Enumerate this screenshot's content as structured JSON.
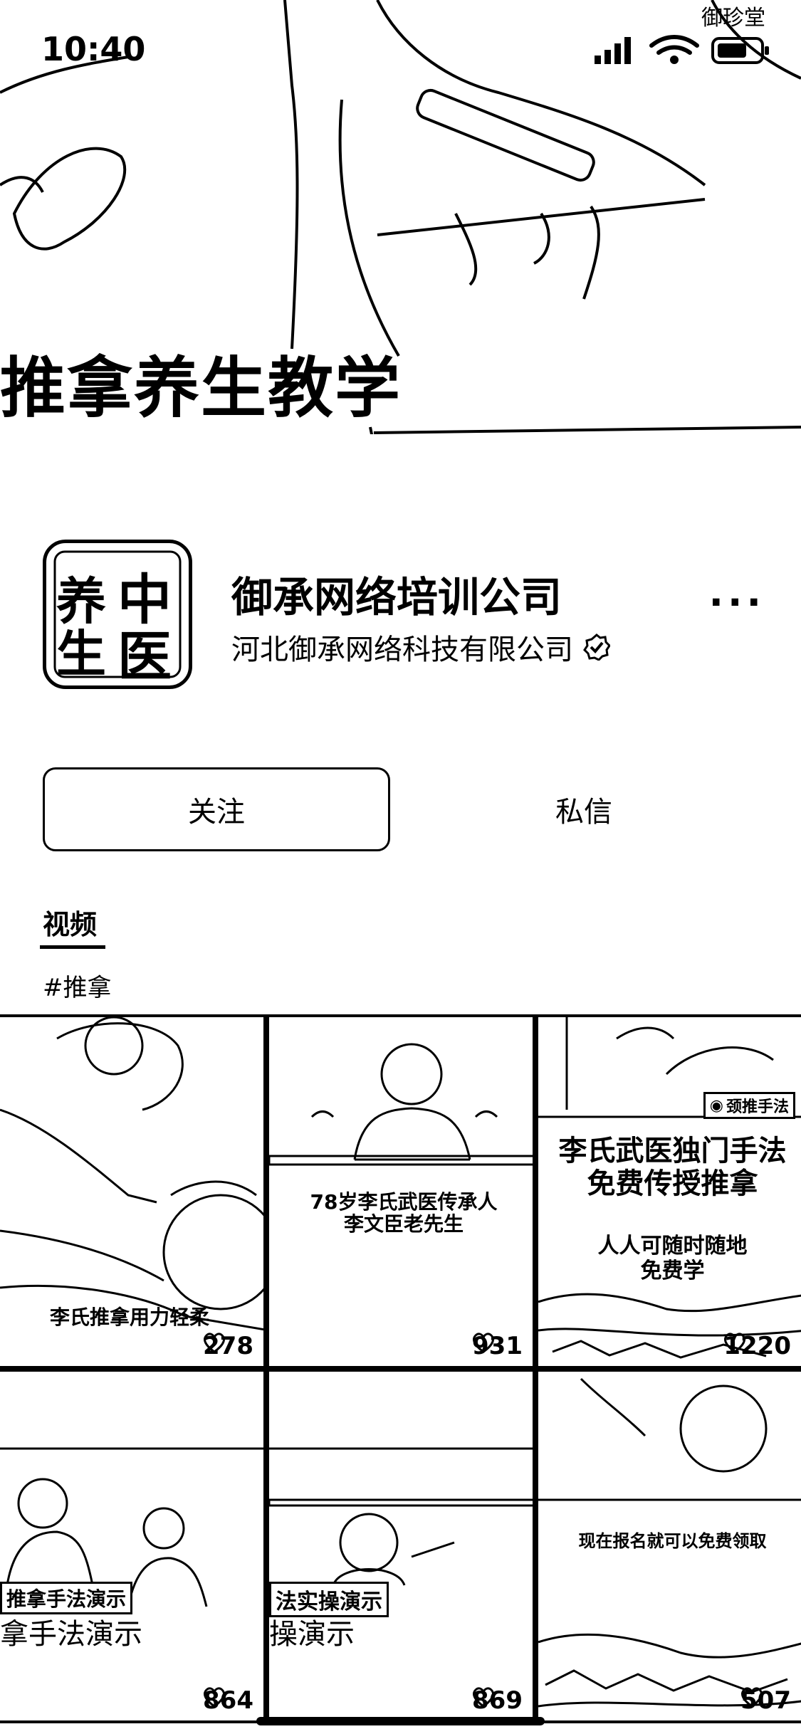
{
  "status_bar": {
    "time": "10:40"
  },
  "cover": {
    "title": "推拿养生教学",
    "corner_text": "御珍堂"
  },
  "profile": {
    "avatar_chars": [
      "中",
      "医",
      "养",
      "生"
    ],
    "name": "御承网络培训公司",
    "company": "河北御承网络科技有限公司",
    "more": "···"
  },
  "actions": {
    "follow": "关注",
    "message": "私信"
  },
  "tabs": {
    "video": "视频"
  },
  "hashtag": "#推拿",
  "videos": [
    {
      "caption": "李氏推拿用力轻柔",
      "likes": "278"
    },
    {
      "caption": "78岁李氏武医传承人\n李文臣老先生",
      "likes": "931"
    },
    {
      "caption_top": "李氏武医独门手法\n免费传授推拿",
      "caption_sub": "人人可随时随地\n免费学",
      "badge": "颈推手法",
      "likes": "1220"
    },
    {
      "caption_small": "推拿手法演示",
      "caption_big": "拿手法演示",
      "likes": "864"
    },
    {
      "caption_small": "法实操演示",
      "caption_big": "操演示",
      "likes": "869"
    },
    {
      "caption": "现在报名就可以免费领取",
      "likes": "507"
    }
  ]
}
